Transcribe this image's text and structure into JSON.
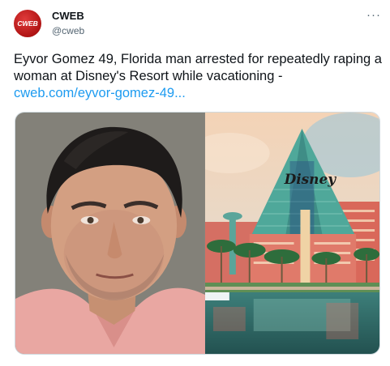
{
  "tweet": {
    "avatar_text": "CWEB",
    "display_name": "CWEB",
    "handle": "@cweb",
    "more_glyph": "···",
    "text": "Eyvor Gomez 49, Florida man arrested for repeatedly raping a woman at Disney's Resort while vacationing - ",
    "link_text": "cweb.com/eyvor-gomez-49...",
    "media": {
      "left_photo": "mugshot-photo",
      "right_photo": "resort-photo",
      "logo_text": "Disney"
    }
  },
  "colors": {
    "link": "#1d9bf0",
    "avatar": "#c41e1e",
    "secondary_text": "#536471"
  }
}
